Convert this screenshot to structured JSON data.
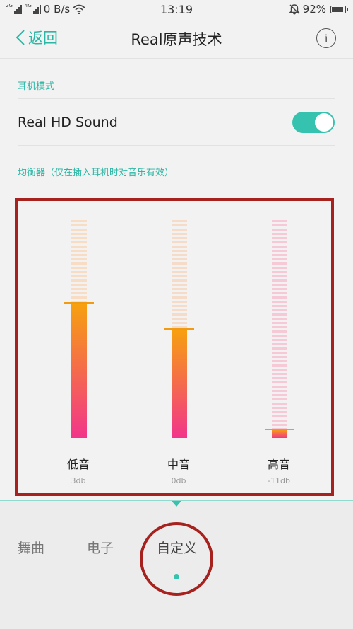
{
  "status_bar": {
    "network_tag_1": "2G",
    "network_tag_2": "4G",
    "speed": "0 B/s",
    "time": "13:19",
    "battery": "92%",
    "icons": [
      "signal-icon",
      "wifi-icon",
      "alarm-off-icon",
      "battery-icon"
    ]
  },
  "nav": {
    "back_label": "返回",
    "title": "Real原声技术",
    "info_glyph": "i"
  },
  "earphone_section": {
    "label": "耳机模式",
    "row_label": "Real HD Sound",
    "toggle_on": true
  },
  "equalizer": {
    "label": "均衡器（仅在插入耳机时对音乐有效）",
    "bands": [
      {
        "name": "低音",
        "value": "3db",
        "level": 0.62
      },
      {
        "name": "中音",
        "value": "0db",
        "level": 0.5
      },
      {
        "name": "高音",
        "value": "-11db",
        "level": 0.04
      }
    ]
  },
  "presets": {
    "items": [
      "舞曲",
      "电子",
      "自定义"
    ],
    "active_index": 2
  },
  "colors": {
    "accent": "#35c3b0",
    "annotation": "#a6221e",
    "fill_top": "#f7a10e",
    "fill_bottom": "#f2358a"
  }
}
